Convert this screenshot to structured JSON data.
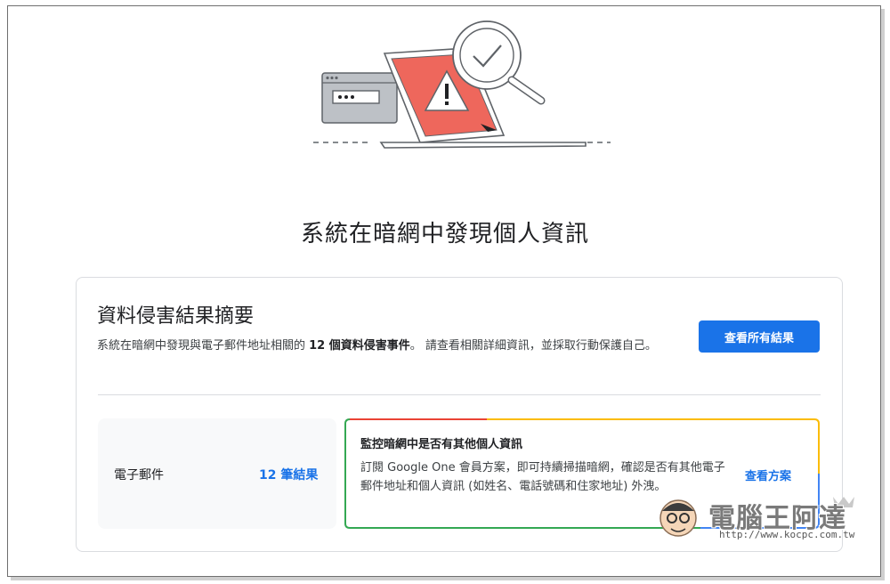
{
  "page": {
    "headline": "系統在暗網中發現個人資訊"
  },
  "summary": {
    "title": "資料侵害結果摘要",
    "desc_prefix": "系統在暗網中發現與電子郵件地址相關的 ",
    "desc_count": "12 個資料侵害事件",
    "desc_suffix": "。 請查看相關詳細資訊，並採取行動保護自己。",
    "view_all_label": "查看所有結果"
  },
  "email": {
    "label": "電子郵件",
    "results_link": "12 筆結果"
  },
  "promo": {
    "title": "監控暗網中是否有其他個人資訊",
    "text": "訂閱 Google One 會員方案，即可持續掃描暗網，確認是否有其他電子郵件地址和個人資訊 (如姓名、電話號碼和住家地址) 外洩。",
    "link": "查看方案",
    "border_colors": [
      "#ea4335",
      "#fbbc04",
      "#34a853",
      "#4285f4"
    ]
  },
  "watermark": {
    "text": "電腦王阿達",
    "url": "http://www.kocpc.com.tw"
  },
  "colors": {
    "primary": "#1a73e8",
    "alert_red": "#ee675c"
  },
  "icons": {
    "hero": "laptop-warning-magnifier-illustration"
  }
}
